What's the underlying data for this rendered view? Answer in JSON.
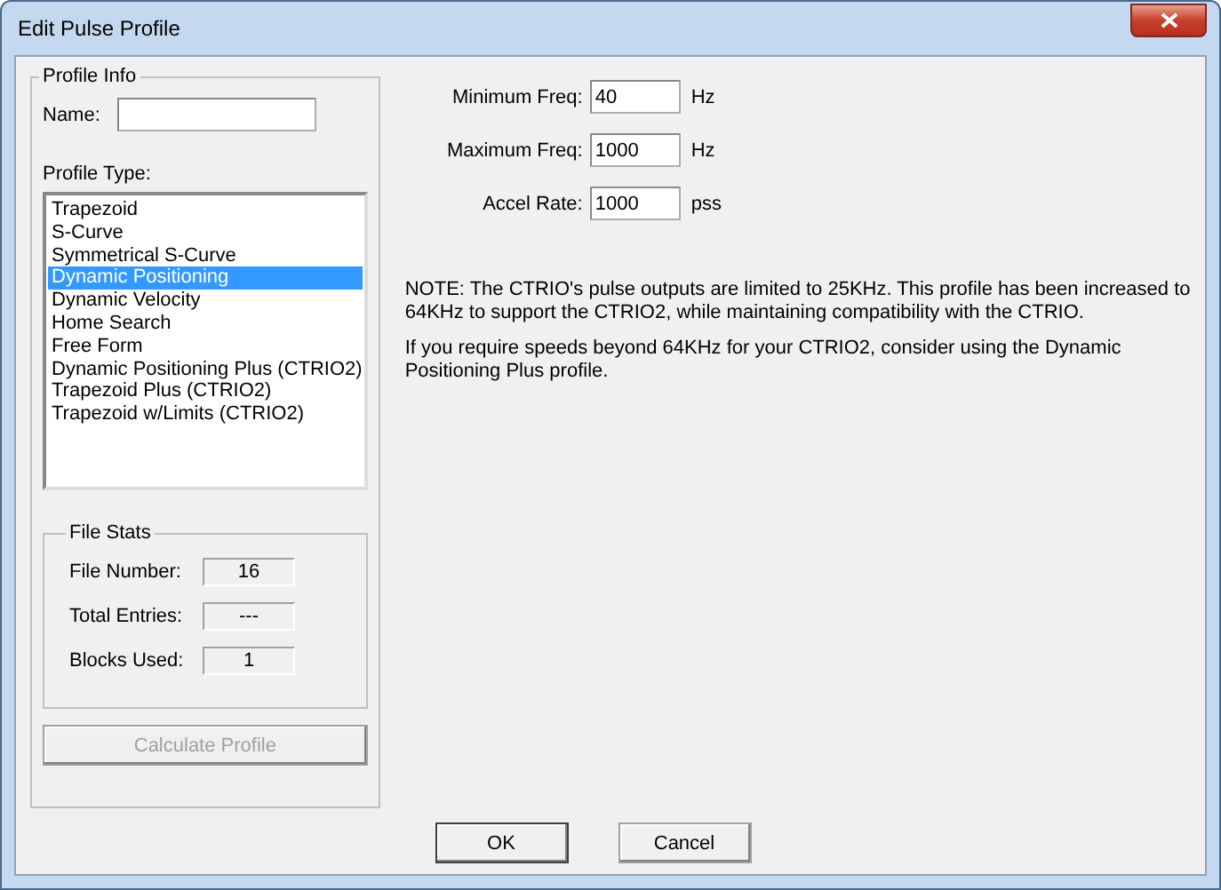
{
  "window": {
    "title": "Edit Pulse Profile"
  },
  "profile_info": {
    "title": "Profile Info",
    "name_label": "Name:",
    "type_label": "Profile Type:",
    "profile_types": [
      {
        "label": "Trapezoid",
        "selected": false
      },
      {
        "label": "S-Curve",
        "selected": false
      },
      {
        "label": "Symmetrical S-Curve",
        "selected": false
      },
      {
        "label": "Dynamic Positioning",
        "selected": true
      },
      {
        "label": "Dynamic Velocity",
        "selected": false
      },
      {
        "label": "Home Search",
        "selected": false
      },
      {
        "label": "Free Form",
        "selected": false
      },
      {
        "label": "Dynamic Positioning Plus (CTRIO2)",
        "selected": false
      },
      {
        "label": "Trapezoid Plus (CTRIO2)",
        "selected": false
      },
      {
        "label": "Trapezoid w/Limits (CTRIO2)",
        "selected": false
      }
    ]
  },
  "file_stats": {
    "title": "File Stats",
    "rows": [
      {
        "label": "File Number:",
        "value": "16"
      },
      {
        "label": "Total Entries:",
        "value": "---"
      },
      {
        "label": "Blocks Used:",
        "value": "1"
      }
    ]
  },
  "calculate_button": {
    "label": "Calculate Profile",
    "disabled": true
  },
  "parameters": [
    {
      "label": "Minimum Freq:",
      "value": "40",
      "unit": "Hz"
    },
    {
      "label": "Maximum Freq:",
      "value": "1000",
      "unit": "Hz"
    },
    {
      "label": "Accel Rate:",
      "value": "1000",
      "unit": "pss"
    }
  ],
  "notes": [
    "NOTE: The CTRIO's pulse outputs are limited to 25KHz. This profile has been increased to 64KHz to support the CTRIO2, while maintaining compatibility with the CTRIO.",
    "If you require speeds beyond 64KHz for your CTRIO2, consider using the Dynamic Positioning Plus profile."
  ],
  "buttons": [
    {
      "label": "OK",
      "default": true
    },
    {
      "label": "Cancel",
      "default": false
    }
  ]
}
